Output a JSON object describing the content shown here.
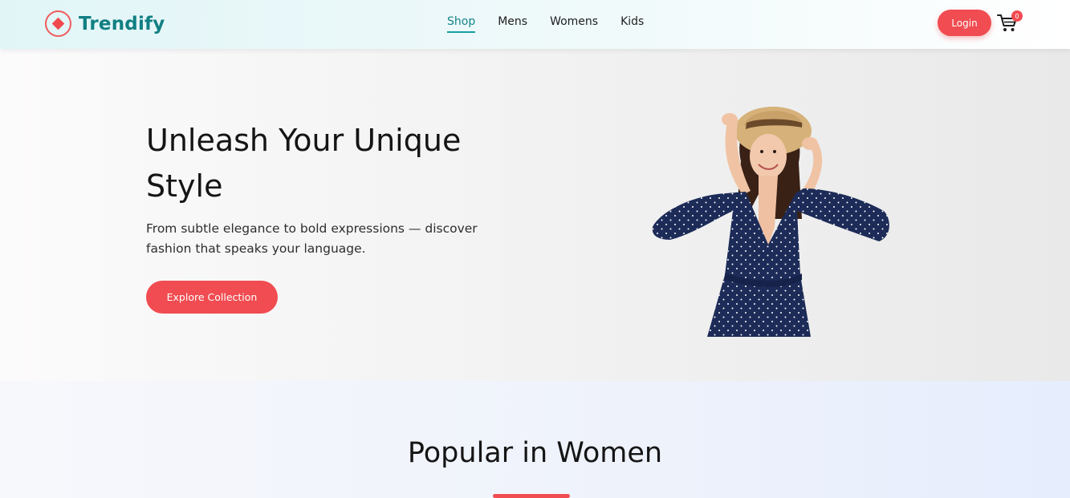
{
  "brand": {
    "name": "Trendify",
    "logo_icon": "diamond-in-circle-icon"
  },
  "nav": {
    "links": [
      {
        "label": "Shop",
        "active": true
      },
      {
        "label": "Mens",
        "active": false
      },
      {
        "label": "Womens",
        "active": false
      },
      {
        "label": "Kids",
        "active": false
      }
    ],
    "login_label": "Login",
    "cart_icon": "cart-icon",
    "cart_count": "0"
  },
  "hero": {
    "title": "Unleash Your Unique Style",
    "subtitle": "From subtle elegance to bold expressions — discover fashion that speaks your language.",
    "cta_label": "Explore Collection",
    "image": "woman-in-straw-hat-and-navy-polka-dot-jumpsuit"
  },
  "popular": {
    "title": "Popular in Women"
  },
  "colors": {
    "accent": "#f04c51",
    "brand": "#117f83",
    "nav_active": "#14848a"
  }
}
